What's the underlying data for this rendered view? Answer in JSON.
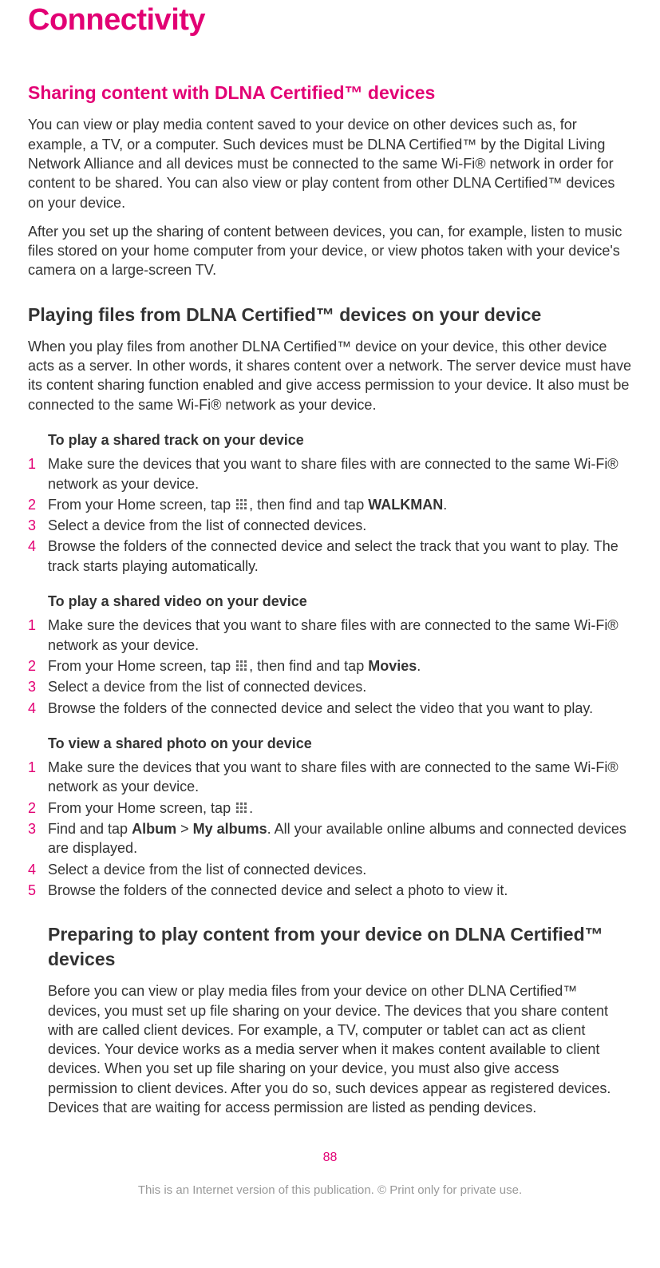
{
  "page": {
    "title": "Connectivity",
    "section1": {
      "title": "Sharing content with DLNA Certified™ devices",
      "para1": "You can view or play media content saved to your device on other devices such as, for example, a TV, or a computer. Such devices must be DLNA Certified™ by the Digital Living Network Alliance and all devices must be connected to the same Wi-Fi® network in order for content to be shared. You can also view or play content from other DLNA Certified™ devices on your device.",
      "para2": "After you set up the sharing of content between devices, you can, for example, listen to music files stored on your home computer from your device, or view photos taken with your device's camera on a large-screen TV."
    },
    "section2": {
      "title": "Playing files from DLNA Certified™ devices on your device",
      "para1": "When you play files from another DLNA Certified™ device on your device, this other device acts as a server. In other words, it shares content over a network. The server device must have its content sharing function enabled and give access permission to your device. It also must be connected to the same Wi-Fi® network as your device."
    },
    "task1": {
      "heading": "To play a shared track on your device",
      "steps": {
        "s1": "Make sure the devices that you want to share files with are connected to the same Wi-Fi® network as your device.",
        "s2a": "From your Home screen, tap ",
        "s2b": ", then find and tap ",
        "s2c": "WALKMAN",
        "s2d": ".",
        "s3": "Select a device from the list of connected devices.",
        "s4": "Browse the folders of the connected device and select the track that you want to play. The track starts playing automatically."
      }
    },
    "task2": {
      "heading": "To play a shared video on your device",
      "steps": {
        "s1": "Make sure the devices that you want to share files with are connected to the same Wi-Fi® network as your device.",
        "s2a": "From your Home screen, tap ",
        "s2b": ", then find and tap ",
        "s2c": "Movies",
        "s2d": ".",
        "s3": "Select a device from the list of connected devices.",
        "s4": "Browse the folders of the connected device and select the video that you want to play."
      }
    },
    "task3": {
      "heading": "To view a shared photo on your device",
      "steps": {
        "s1": "Make sure the devices that you want to share files with are connected to the same Wi-Fi® network as your device.",
        "s2a": "From your Home screen, tap ",
        "s2b": ".",
        "s3a": "Find and tap ",
        "s3b": "Album",
        "s3c": " > ",
        "s3d": "My albums",
        "s3e": ". All your available online albums and connected devices are displayed.",
        "s4": "Select a device from the list of connected devices.",
        "s5": "Browse the folders of the connected device and select a photo to view it."
      }
    },
    "section3": {
      "title": "Preparing to play content from your device on DLNA Certified™ devices",
      "para1": "Before you can view or play media files from your device on other DLNA Certified™ devices, you must set up file sharing on your device. The devices that you share content with are called client devices. For example, a TV, computer or tablet can act as client devices. Your device works as a media server when it makes content available to client devices. When you set up file sharing on your device, you must also give access permission to client devices. After you do so, such devices appear as registered devices. Devices that are waiting for access permission are listed as pending devices."
    },
    "pageNumber": "88",
    "footer": "This is an Internet version of this publication. © Print only for private use."
  }
}
